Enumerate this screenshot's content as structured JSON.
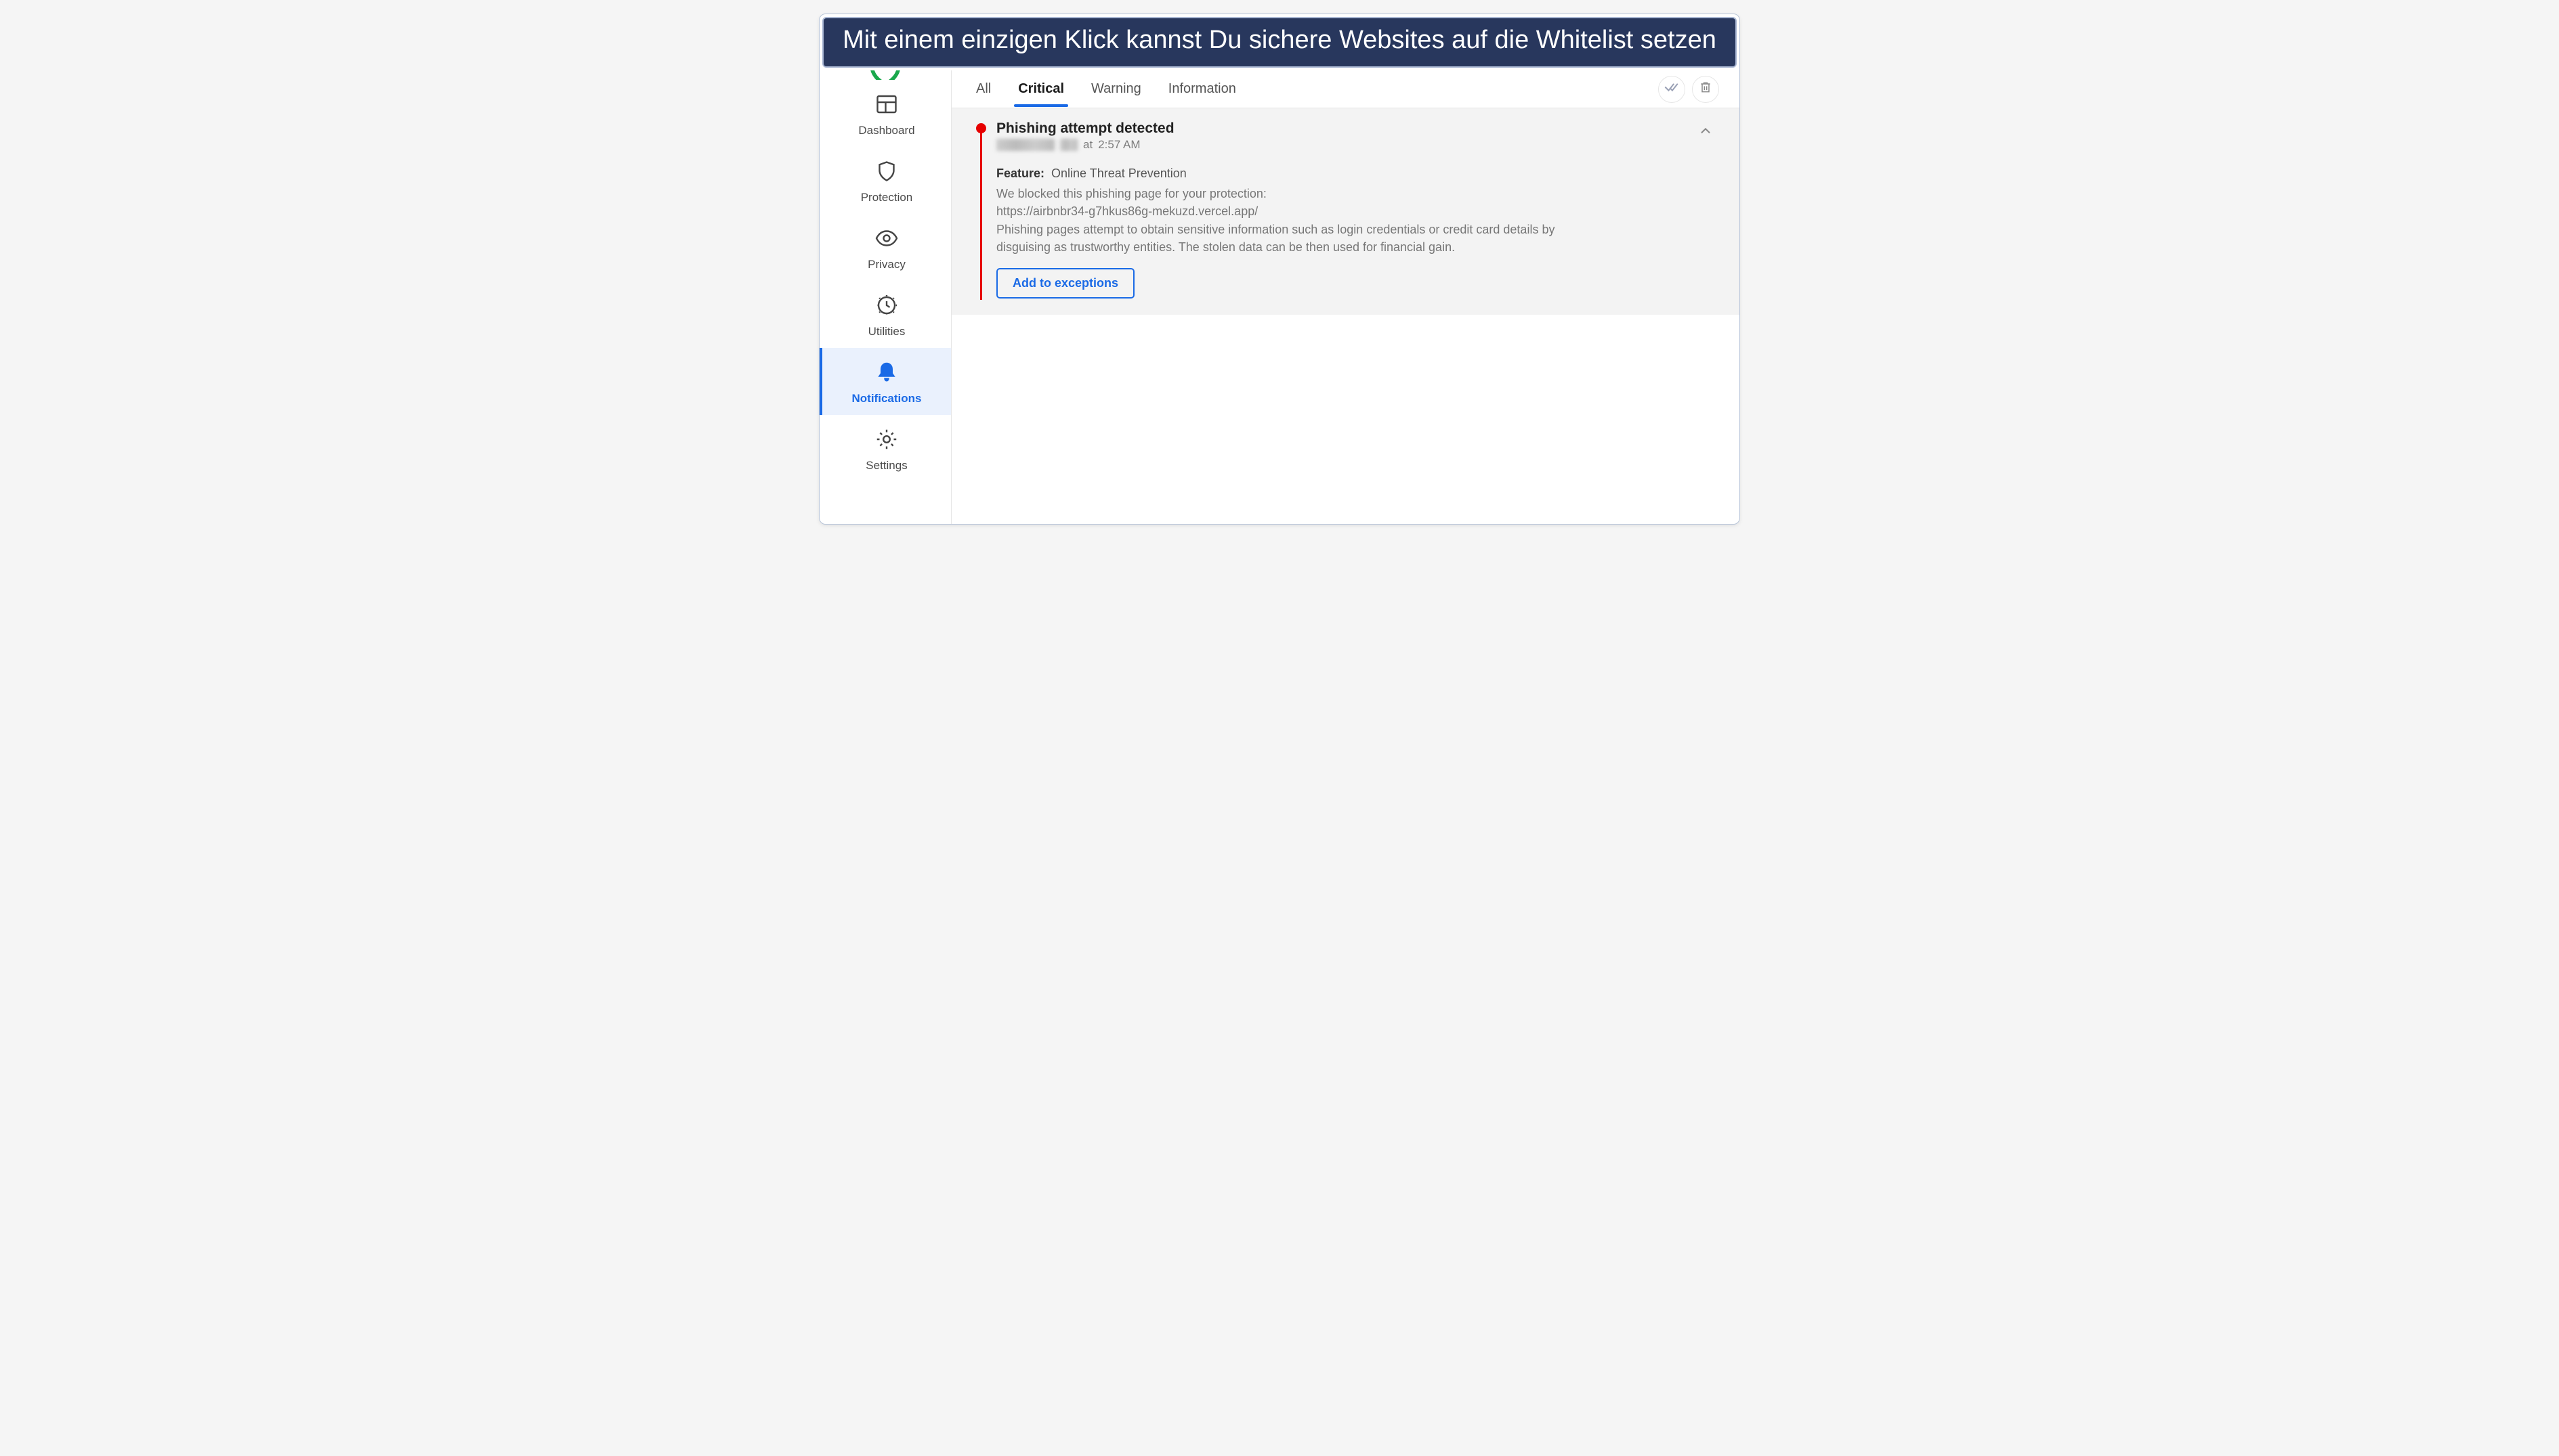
{
  "banner": {
    "text": "Mit einem einzigen Klick kannst Du sichere Websites auf die Whitelist setzen"
  },
  "sidebar": {
    "items": [
      {
        "label": "Dashboard"
      },
      {
        "label": "Protection"
      },
      {
        "label": "Privacy"
      },
      {
        "label": "Utilities"
      },
      {
        "label": "Notifications"
      },
      {
        "label": "Settings"
      }
    ]
  },
  "tabs": {
    "all": "All",
    "critical": "Critical",
    "warning": "Warning",
    "information": "Information"
  },
  "notification": {
    "title": "Phishing attempt detected",
    "time_prefix": "at",
    "time": "2:57 AM",
    "feature_label": "Feature:",
    "feature_value": "Online Threat Prevention",
    "desc_intro": "We blocked this phishing page for your protection:",
    "desc_url": "https://airbnbr34-g7hkus86g-mekuzd.vercel.app/",
    "desc_body": "Phishing pages attempt to obtain sensitive information such as login credentials or credit card details by disguising as trustworthy entities. The stolen data can be then used for financial gain.",
    "action_label": "Add to exceptions"
  }
}
